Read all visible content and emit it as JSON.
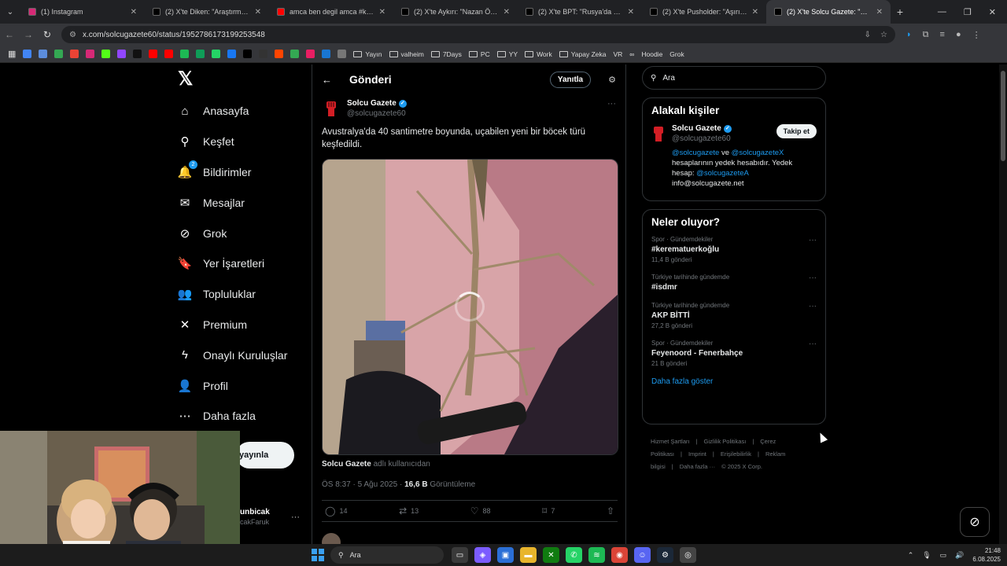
{
  "browser": {
    "tabs": [
      {
        "title": "(1) Instagram",
        "color": "#d62976",
        "active": false
      },
      {
        "title": "(2) X'te Diken: \"Araştırma: Dişi g",
        "color": "#000000",
        "active": false
      },
      {
        "title": "amca ben degil amca #keşfet #",
        "color": "#ff0000",
        "active": false
      },
      {
        "title": "(2) X'te Aykırı: \"Nazan Öncel, Ya",
        "color": "#000000",
        "active": false
      },
      {
        "title": "(2) X'te BPT: \"Rusya'da bir feno",
        "color": "#000000",
        "active": false
      },
      {
        "title": "(2) X'te Pusholder: \"Aşırı karpu",
        "color": "#000000",
        "active": false
      },
      {
        "title": "(2) X'te Solcu Gazete: \"Avustral",
        "color": "#000000",
        "active": true
      }
    ],
    "url": "x.com/solcugazete60/status/1952786173199253548",
    "bookmarks": [
      {
        "type": "icon",
        "color": "#4285f4"
      },
      {
        "type": "icon",
        "color": "#5c8ddc"
      },
      {
        "type": "icon",
        "color": "#34a853"
      },
      {
        "type": "icon",
        "color": "#ea4335"
      },
      {
        "type": "icon",
        "color": "#d62976"
      },
      {
        "type": "icon",
        "color": "#53fc18"
      },
      {
        "type": "icon",
        "color": "#9146ff"
      },
      {
        "type": "icon",
        "color": "#111111"
      },
      {
        "type": "icon",
        "color": "#ff0000"
      },
      {
        "type": "icon",
        "color": "#ff0000"
      },
      {
        "type": "icon",
        "color": "#1db954"
      },
      {
        "type": "icon",
        "color": "#0f9d58"
      },
      {
        "type": "icon",
        "color": "#25d366"
      },
      {
        "type": "icon",
        "color": "#1877f2"
      },
      {
        "type": "icon",
        "color": "#000000"
      },
      {
        "type": "icon",
        "color": "#333333"
      },
      {
        "type": "icon",
        "color": "#ff4500"
      },
      {
        "type": "icon",
        "color": "#34a853"
      },
      {
        "type": "icon",
        "color": "#e91e63"
      },
      {
        "type": "icon",
        "color": "#1976d2"
      },
      {
        "type": "icon",
        "color": "#777777"
      },
      {
        "type": "folder",
        "label": "Yayın"
      },
      {
        "type": "folder",
        "label": "valheim"
      },
      {
        "type": "folder",
        "label": "7Days"
      },
      {
        "type": "folder",
        "label": "PC"
      },
      {
        "type": "folder",
        "label": "YY"
      },
      {
        "type": "folder",
        "label": "Work"
      },
      {
        "type": "folder",
        "label": "Yapay Zeka"
      },
      {
        "type": "text",
        "label": "VR"
      },
      {
        "type": "text",
        "label": "∞"
      },
      {
        "type": "text",
        "label": "Hoodie"
      },
      {
        "type": "text",
        "label": "Grok"
      }
    ]
  },
  "nav": {
    "items": [
      {
        "label": "Anasayfa",
        "icon": "home-icon",
        "glyph": "⌂"
      },
      {
        "label": "Keşfet",
        "icon": "search-icon",
        "glyph": "⚲"
      },
      {
        "label": "Bildirimler",
        "icon": "bell-icon",
        "glyph": "🔔",
        "badge": "2"
      },
      {
        "label": "Mesajlar",
        "icon": "mail-icon",
        "glyph": "✉"
      },
      {
        "label": "Grok",
        "icon": "grok-icon",
        "glyph": "⊘"
      },
      {
        "label": "Yer İşaretleri",
        "icon": "bookmark-icon",
        "glyph": "🔖"
      },
      {
        "label": "Topluluklar",
        "icon": "communities-icon",
        "glyph": "👥"
      },
      {
        "label": "Premium",
        "icon": "x-premium-icon",
        "glyph": "✕"
      },
      {
        "label": "Onaylı Kuruluşlar",
        "icon": "lightning-icon",
        "glyph": "ϟ"
      },
      {
        "label": "Profil",
        "icon": "profile-icon",
        "glyph": "👤"
      },
      {
        "label": "Daha fazla",
        "icon": "more-circle-icon",
        "glyph": "⋯"
      }
    ],
    "post_button": "yayınla",
    "account_name": "unbicak",
    "account_handle": "cakFaruk"
  },
  "post": {
    "header_title": "Gönderi",
    "reply_button": "Yanıtla",
    "author_name": "Solcu Gazete",
    "author_handle": "@solcugazete60",
    "text": "Avustralya'da 40 santimetre boyunda, uçabilen yeni bir böcek türü keşfedildi.",
    "from_user": "Solcu Gazete",
    "from_suffix": "adlı kullanıcıdan",
    "timestamp": "ÖS 8:37 · 5 Ağu 2025 ·",
    "views": "16,6 B",
    "views_label": "Görüntüleme",
    "replies": "14",
    "reposts": "13",
    "likes": "88",
    "bookmarks": "7"
  },
  "sidebar": {
    "search_placeholder": "Ara",
    "relevant_title": "Alakalı kişiler",
    "rel_name": "Solcu Gazete",
    "rel_handle": "@solcugazete60",
    "follow_label": "Takip et",
    "bio_link1": "@solcugazete",
    "bio_and": " ve ",
    "bio_link2": "@solcugazeteX",
    "bio_text": " hesaplarının yedek hesabıdır. Yedek hesap: ",
    "bio_link3": "@solcugazeteA",
    "bio_email": "info@solcugazete.net",
    "trends_title": "Neler oluyor?",
    "trends": [
      {
        "context": "Spor · Gündemdekiler",
        "name": "#kerematuerkoğlu",
        "count": "11,4 B gönderi"
      },
      {
        "context": "Türkiye tarihinde gündemde",
        "name": "#isdmr",
        "count": ""
      },
      {
        "context": "Türkiye tarihinde gündemde",
        "name": "AKP BİTTİ",
        "count": "27,2 B gönderi"
      },
      {
        "context": "Spor · Gündemdekiler",
        "name": "Feyenoord - Fenerbahçe",
        "count": "21 B gönderi"
      }
    ],
    "show_more": "Daha fazla göster",
    "footer_links": [
      "Hizmet Şartları",
      "|",
      "Gizlilik Politikası",
      "|",
      "Çerez Politikası",
      "|",
      "Imprint",
      "|",
      "Erişilebilirlik",
      "|",
      "Reklam bilgisi",
      "|",
      "Daha fazla ···",
      "© 2025 X Corp."
    ]
  },
  "taskbar": {
    "search_label": "Ara",
    "time": "21:48",
    "date": "6.08.2025"
  },
  "colors": {
    "accent": "#1d9bf0",
    "background": "#000000",
    "border": "#2f3336",
    "muted": "#71767b"
  }
}
